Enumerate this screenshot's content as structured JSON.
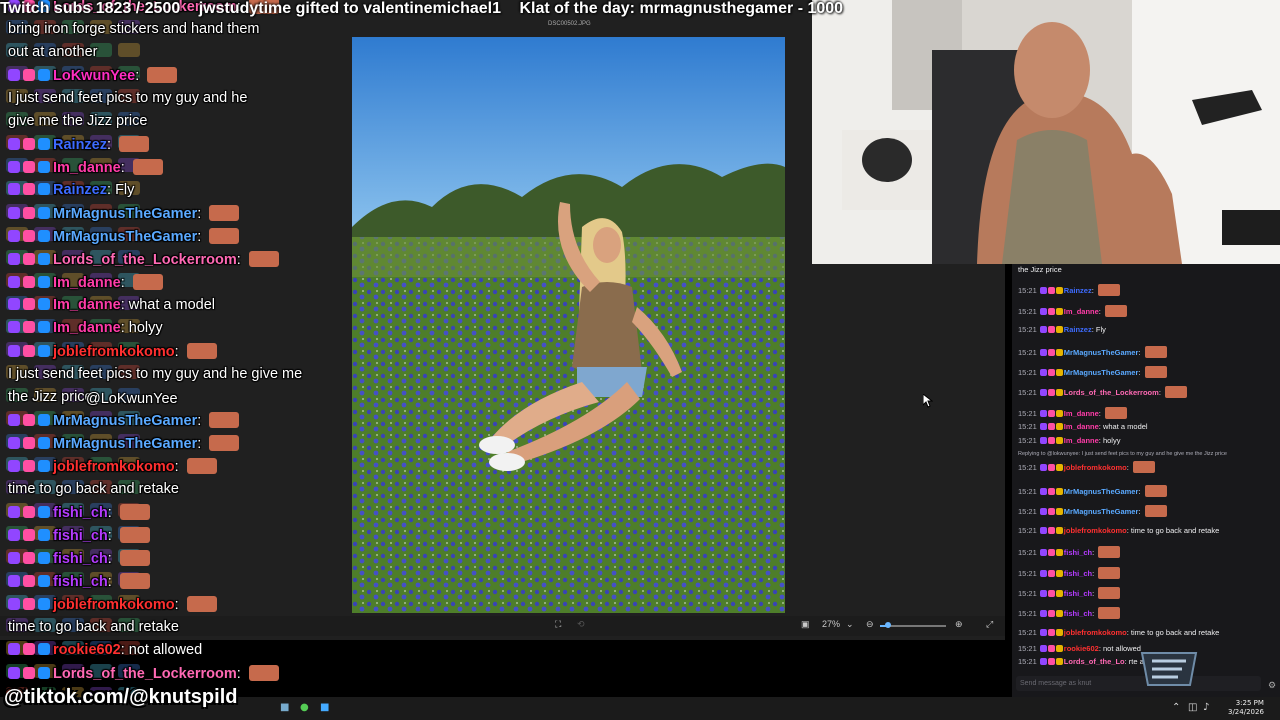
{
  "ticker": {
    "text": "jwstudytime gifted to valentinemichael1",
    "klat": "Klat of the day: mrmagnusthegamer - 1000",
    "partial_left": "Twitch subs 1823 / 2500"
  },
  "viewer": {
    "filename": "DSC00502.JPG",
    "zoom": "27%",
    "zoom_level": 0.12
  },
  "overlay_chat": [
    {
      "user": "Lords_of_the_Lockerroom",
      "color": "#ff69b4",
      "text": ""
    },
    {
      "user": "",
      "color": "#ffffff",
      "text": "bring iron forge stickers and hand them"
    },
    {
      "user": "",
      "color": "#ffffff",
      "text": "out at another"
    },
    {
      "user": "LoKwunYee",
      "color": "#ff2ec2",
      "text": ""
    },
    {
      "user": "",
      "color": "#ffffff",
      "text": "I just send feet pics to my guy and he"
    },
    {
      "user": "",
      "color": "#ffffff",
      "text": "give me the Jizz price"
    },
    {
      "user": "Rainzez",
      "color": "#3d6bff",
      "text": ""
    },
    {
      "user": "Im_danne",
      "color": "#ff3ca8",
      "text": ""
    },
    {
      "user": "Rainzez",
      "color": "#3d6bff",
      "text": "Fly"
    },
    {
      "user": "MrMagnusTheGamer",
      "color": "#5aa9ff",
      "text": ""
    },
    {
      "user": "MrMagnusTheGamer",
      "color": "#5aa9ff",
      "text": ""
    },
    {
      "user": "Lords_of_the_Lockerroom",
      "color": "#ff69b4",
      "text": ""
    },
    {
      "user": "Im_danne",
      "color": "#ff3ca8",
      "text": ""
    },
    {
      "user": "Im_danne",
      "color": "#ff3ca8",
      "text": "what a model"
    },
    {
      "user": "Im_danne",
      "color": "#ff3ca8",
      "text": "holyy"
    },
    {
      "user": "joblefromkokomo",
      "color": "#ff3030",
      "text": ""
    },
    {
      "user": "",
      "color": "#ffffff",
      "text": "I just send feet pics to my guy and he give me"
    },
    {
      "user": "",
      "color": "#ffffff",
      "text": "the Jizz price"
    },
    {
      "user": "MrMagnusTheGamer",
      "color": "#5aa9ff",
      "text": ""
    },
    {
      "user": "MrMagnusTheGamer",
      "color": "#5aa9ff",
      "text": ""
    },
    {
      "user": "joblefromkokomo",
      "color": "#ff3030",
      "text": ""
    },
    {
      "user": "",
      "color": "#ffffff",
      "text": "time to go back and retake"
    },
    {
      "user": "fishi_ch",
      "color": "#b43cff",
      "text": ""
    },
    {
      "user": "fishi_ch",
      "color": "#b43cff",
      "text": ""
    },
    {
      "user": "fishi_ch",
      "color": "#b43cff",
      "text": ""
    },
    {
      "user": "fishi_ch",
      "color": "#b43cff",
      "text": ""
    },
    {
      "user": "joblefromkokomo",
      "color": "#ff3030",
      "text": ""
    },
    {
      "user": "",
      "color": "#ffffff",
      "text": "time to go back and retake"
    },
    {
      "user": "rookie602",
      "color": "#ff3030",
      "text": "not allowed"
    },
    {
      "user": "Lords_of_the_Lockerroom",
      "color": "#ff69b4",
      "text": ""
    }
  ],
  "overlay_mention": "@LoKwunYee",
  "chat_panel": {
    "top_partial": "the Jizz price",
    "reply_note": "Replying to @lokwunyee: I just send feet pics to my guy and he give me the Jizz price",
    "input_placeholder": "Send message as knut",
    "messages": [
      {
        "time": "15:21",
        "user": "Rainzez",
        "color": "#3d6bff",
        "text": ""
      },
      {
        "time": "15:21",
        "user": "Im_danne",
        "color": "#ff3ca8",
        "text": ""
      },
      {
        "time": "15:21",
        "user": "Rainzez",
        "color": "#3d6bff",
        "text": "Fly"
      },
      {
        "time": "15:21",
        "user": "MrMagnusTheGamer",
        "color": "#5aa9ff",
        "text": ""
      },
      {
        "time": "15:21",
        "user": "MrMagnusTheGamer",
        "color": "#5aa9ff",
        "text": ""
      },
      {
        "time": "15:21",
        "user": "Lords_of_the_Lockerroom",
        "color": "#ff69b4",
        "text": ""
      },
      {
        "time": "15:21",
        "user": "Im_danne",
        "color": "#ff3ca8",
        "text": ""
      },
      {
        "time": "15:21",
        "user": "Im_danne",
        "color": "#ff3ca8",
        "text": "what a model"
      },
      {
        "time": "15:21",
        "user": "Im_danne",
        "color": "#ff3ca8",
        "text": "holyy"
      },
      {
        "time": "15:21",
        "user": "joblefromkokomo",
        "color": "#ff3030",
        "text": ""
      },
      {
        "time": "15:21",
        "user": "MrMagnusTheGamer",
        "color": "#5aa9ff",
        "text": ""
      },
      {
        "time": "15:21",
        "user": "MrMagnusTheGamer",
        "color": "#5aa9ff",
        "text": ""
      },
      {
        "time": "15:21",
        "user": "joblefromkokomo",
        "color": "#ff3030",
        "text": "time to go back and retake"
      },
      {
        "time": "15:21",
        "user": "fishi_ch",
        "color": "#b43cff",
        "text": ""
      },
      {
        "time": "15:21",
        "user": "fishi_ch",
        "color": "#b43cff",
        "text": ""
      },
      {
        "time": "15:21",
        "user": "fishi_ch",
        "color": "#b43cff",
        "text": ""
      },
      {
        "time": "15:21",
        "user": "fishi_ch",
        "color": "#b43cff",
        "text": ""
      },
      {
        "time": "15:21",
        "user": "joblefromkokomo",
        "color": "#ff3030",
        "text": "time to go back and retake"
      },
      {
        "time": "15:21",
        "user": "rookie602",
        "color": "#ff3030",
        "text": "not allowed"
      },
      {
        "time": "15:21",
        "user": "Lords_of_the_Lo",
        "color": "#ff69b4",
        "text": "rte and the ogre"
      }
    ]
  },
  "watermark": "@tiktok.com/@knutspild",
  "taskbar": {
    "time": "3:25 PM",
    "date": "3/24/2026"
  },
  "colors": {
    "sky": "#3d86d1",
    "grass": "#4f7f2c",
    "bluebonnet": "#3c46b8",
    "chat_bg": "#18181b",
    "viewer_bg": "#202020"
  }
}
